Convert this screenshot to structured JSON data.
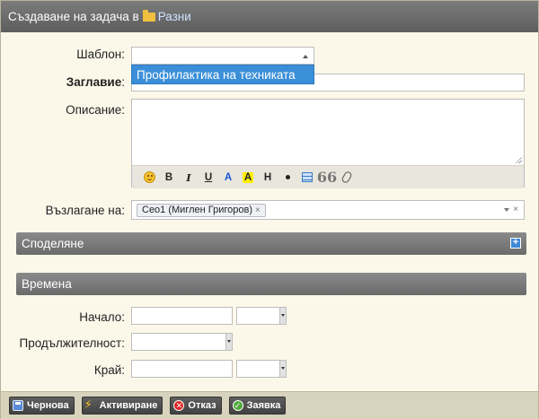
{
  "title": {
    "prefix": "Създаване на задача в",
    "folder_name": "Разни"
  },
  "form": {
    "template_label": "Шаблон:",
    "template_dropdown_option": "Профилактика на техниката",
    "title_label": "Заглавие",
    "title_colon": ":",
    "description_label": "Описание:",
    "assign_label": "Възлагане на:",
    "assignee_chip": "Сео1 (Миглен Григоров)",
    "chip_remove": "×",
    "clear_symbol": "×"
  },
  "editor_toolbar": {
    "bold": "B",
    "italic": "I",
    "underline": "U",
    "text_color": "A",
    "highlight": "A",
    "heading": "H",
    "quote": "66"
  },
  "sections": {
    "sharing": "Споделяне",
    "sharing_toggle": "+",
    "times": "Времена"
  },
  "times": {
    "start_label": "Начало:",
    "duration_label": "Продължителност:",
    "end_label": "Край:"
  },
  "footer": {
    "draft": "Чернова",
    "activate": "Активиране",
    "cancel": "Отказ",
    "submit": "Заявка",
    "cancel_glyph": "✕",
    "submit_glyph": "✓"
  }
}
